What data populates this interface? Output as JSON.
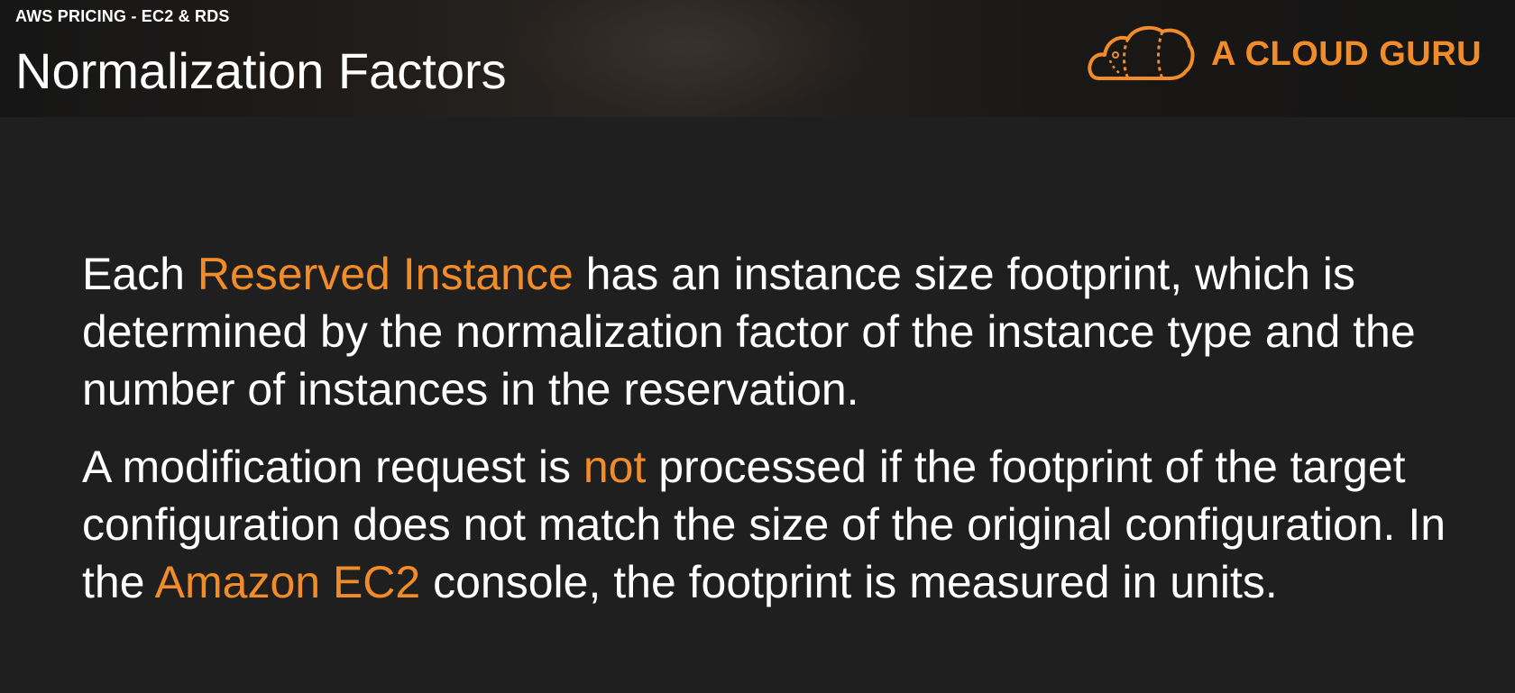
{
  "header": {
    "section_label": "AWS PRICING - EC2 & RDS",
    "title": "Normalization Factors"
  },
  "brand": {
    "name": "A CLOUD GURU",
    "logo_icon": "cloud-guru-logo-icon",
    "color": "#f28c28"
  },
  "body": {
    "paragraph1": {
      "pre": "Each ",
      "highlight": "Reserved Instance",
      "post": " has an instance size footprint, which is determined by the normalization factor of the instance type and the number of instances in the reservation."
    },
    "paragraph2": {
      "pre": "A modification request is ",
      "highlight1": "not",
      "mid": " processed if the footprint of the target configuration does not match the size of the original configuration. In the ",
      "highlight2": "Amazon EC2",
      "post": " console, the footprint is measured in units."
    }
  },
  "colors": {
    "accent": "#f28c28",
    "text": "#ffffff",
    "background": "#1f1f1f"
  }
}
